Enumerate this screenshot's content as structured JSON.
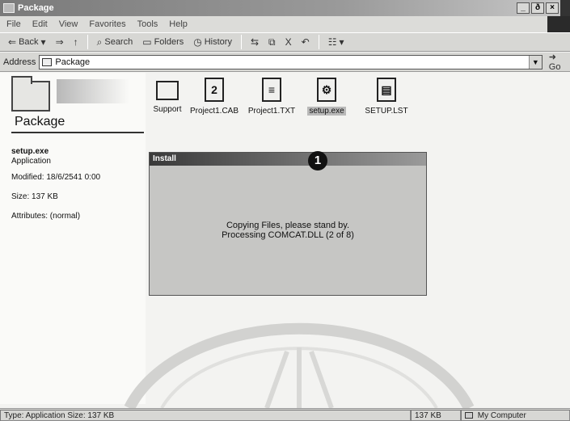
{
  "window": {
    "title": "Package",
    "min": "_",
    "restore": "ð",
    "close": "×"
  },
  "menu": [
    "File",
    "Edit",
    "View",
    "Favorites",
    "Tools",
    "Help"
  ],
  "toolbar": {
    "back": "Back",
    "forward": "⇒",
    "up": "↑",
    "search": "Search",
    "folders": "Folders",
    "history": "History",
    "delete": "X",
    "undo": "↶",
    "views": "☷"
  },
  "address": {
    "label": "Address",
    "value": "Package",
    "go": "Go"
  },
  "left_panel": {
    "title": "Package",
    "selected_name": "setup.exe",
    "selected_type": "Application",
    "modified": "Modified: 18/6/2541 0:00",
    "size": "Size: 137 KB",
    "attributes": "Attributes: (normal)"
  },
  "files": [
    {
      "name": "Support",
      "glyph": ""
    },
    {
      "name": "Project1.CAB",
      "glyph": "2"
    },
    {
      "name": "Project1.TXT",
      "glyph": "≡"
    },
    {
      "name": "setup.exe",
      "glyph": "⚙"
    },
    {
      "name": "SETUP.LST",
      "glyph": "▤"
    }
  ],
  "install": {
    "title": "Install",
    "callout": "1",
    "line1": "Copying Files, please stand by.",
    "line2": "Processing COMCAT.DLL (2 of 8)"
  },
  "status": {
    "left": "Type: Application Size: 137 KB",
    "size": "137 KB",
    "zone": "My Computer"
  }
}
